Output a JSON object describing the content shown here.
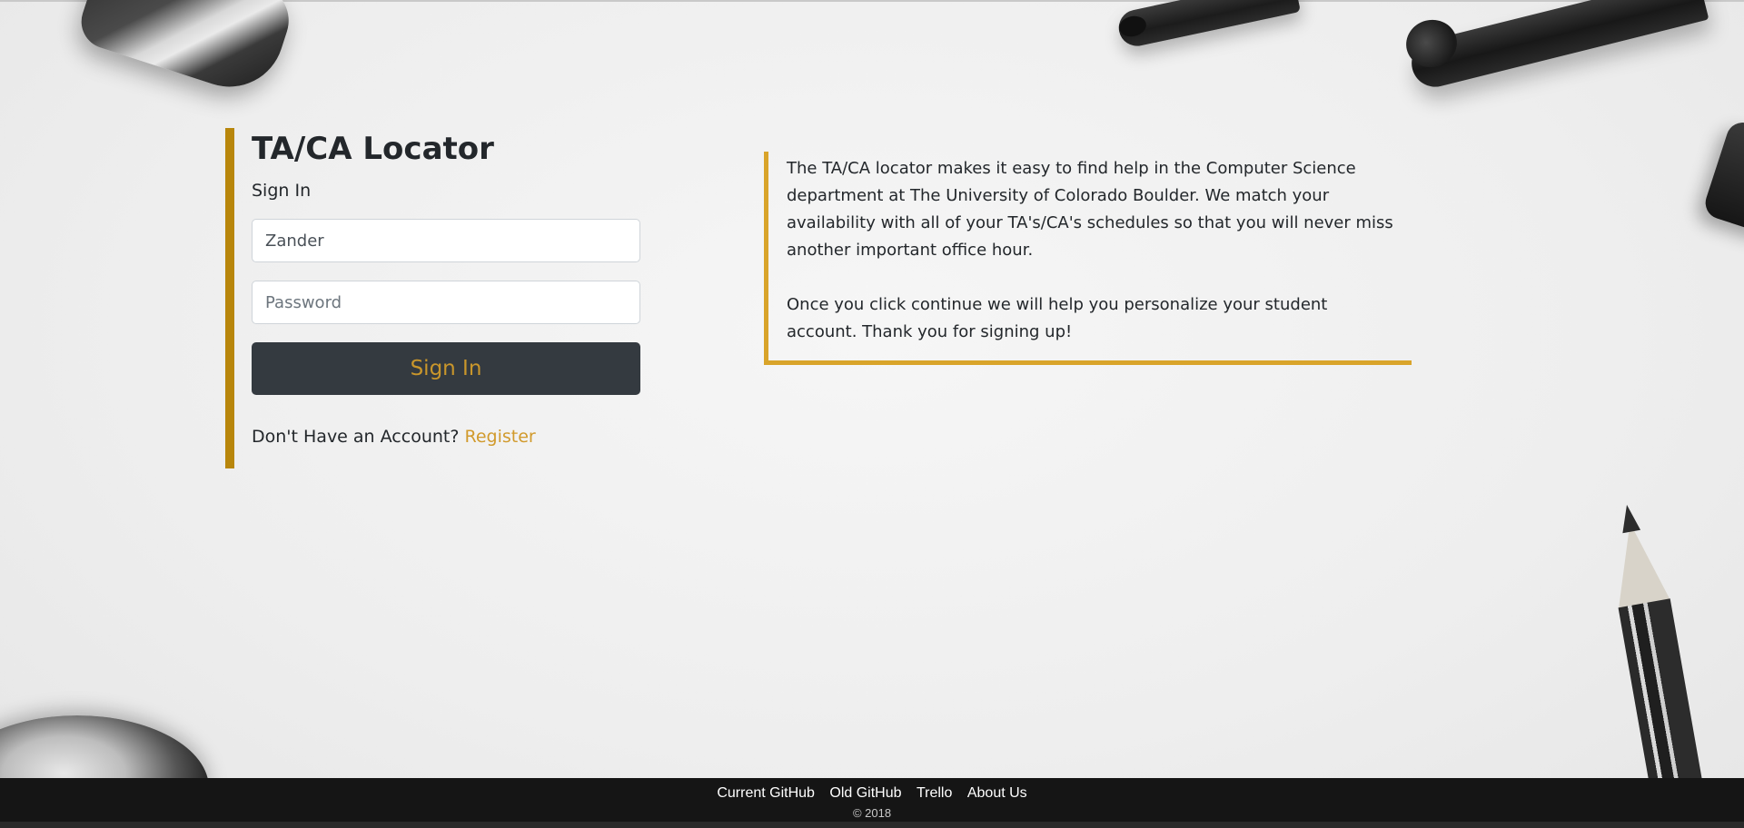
{
  "app": {
    "title": "TA/CA Locator",
    "subtitle": "Sign In"
  },
  "form": {
    "username_value": "Zander",
    "password_placeholder": "Password",
    "submit_label": "Sign In",
    "register_prompt": "Don't Have an Account?",
    "register_link": "Register"
  },
  "info": {
    "paragraph1": "The TA/CA locator makes it easy to find help in the Computer Science department at The University of Colorado Boulder. We match your availability with all of your TA's/CA's schedules so that you will never miss another important office hour.",
    "paragraph2": "Once you click continue we will help you personalize your student account. Thank you for signing up!"
  },
  "footer": {
    "links": [
      "Current GitHub",
      "Old GitHub",
      "Trello",
      "About Us"
    ],
    "copyright": "© 2018"
  },
  "colors": {
    "accent_gold": "#b8860b",
    "info_border": "#d9a42a",
    "button_bg": "#343a40",
    "button_text": "#c9962b",
    "link": "#d19a2c",
    "footer_bg": "#151515"
  }
}
